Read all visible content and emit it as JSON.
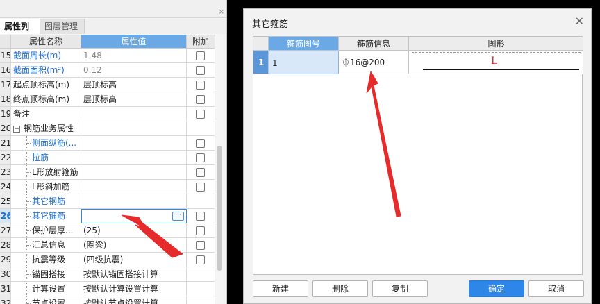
{
  "left_panel": {
    "tabs": [
      "属性列表",
      "图层管理"
    ],
    "close_glyph": "×",
    "header": {
      "name": "属性名称",
      "value": "属性值",
      "attach": "附加"
    },
    "rows": [
      {
        "num": "15",
        "name": "截面周长(m)",
        "value": "1.48",
        "checkbox": true,
        "name_color": "blue",
        "value_color": "gray"
      },
      {
        "num": "16",
        "name": "截面面积(m²)",
        "value": "0.12",
        "checkbox": true,
        "name_color": "blue",
        "value_color": "gray"
      },
      {
        "num": "17",
        "name": "起点顶标高(m)",
        "value": "层顶标高",
        "checkbox": true
      },
      {
        "num": "18",
        "name": "终点顶标高(m)",
        "value": "层顶标高",
        "checkbox": true
      },
      {
        "num": "19",
        "name": "备注",
        "value": "",
        "checkbox": true
      },
      {
        "num": "20",
        "name": "钢筋业务属性",
        "value": "",
        "checkbox": false,
        "expander": "−"
      },
      {
        "num": "21",
        "name": "侧面纵筋(...",
        "value": "",
        "checkbox": true,
        "name_color": "blue",
        "indent": true
      },
      {
        "num": "22",
        "name": "拉筋",
        "value": "",
        "checkbox": true,
        "name_color": "blue",
        "indent": true
      },
      {
        "num": "23",
        "name": "L形放射箍筋",
        "value": "",
        "checkbox": true,
        "indent": true
      },
      {
        "num": "24",
        "name": "L形斜加筋",
        "value": "",
        "checkbox": true,
        "indent": true
      },
      {
        "num": "25",
        "name": "其它钢筋",
        "value": "",
        "checkbox": false,
        "name_color": "blue",
        "indent": true
      },
      {
        "num": "26",
        "name": "其它箍筋",
        "value": "",
        "checkbox": true,
        "name_color": "blue",
        "indent": true,
        "selected": true,
        "edit": true
      },
      {
        "num": "27",
        "name": "保护层厚...",
        "value": "(25)",
        "checkbox": true,
        "indent": true
      },
      {
        "num": "28",
        "name": "汇总信息",
        "value": "(圈梁)",
        "checkbox": true,
        "indent": true
      },
      {
        "num": "29",
        "name": "抗震等级",
        "value": "(四级抗震)",
        "checkbox": true,
        "indent": true
      },
      {
        "num": "30",
        "name": "锚固搭接",
        "value": "按默认锚固搭接计算",
        "checkbox": false,
        "indent": true
      },
      {
        "num": "31",
        "name": "计算设置",
        "value": "按默认计算设置计算",
        "checkbox": false,
        "indent": true
      },
      {
        "num": "32",
        "name": "节点设置",
        "value": "按默认节点设置计算",
        "checkbox": false,
        "indent": true
      }
    ],
    "ellipsis_glyph": "···"
  },
  "dialog": {
    "title": "其它箍筋",
    "close_glyph": "✕",
    "columns": {
      "num": "",
      "code": "箍筋图号",
      "info": "箍筋信息",
      "shape": "图形"
    },
    "rows": [
      {
        "num": "1",
        "code": "1",
        "info": "⏀16@200",
        "shape_label": "L"
      }
    ],
    "buttons": {
      "new": "新建",
      "delete": "删除",
      "copy": "复制",
      "ok": "确定",
      "cancel": "取消"
    }
  },
  "colors": {
    "accent": "#2e86e8",
    "header_blue": "#6aa8e6",
    "arrow": "#e52b2b"
  }
}
